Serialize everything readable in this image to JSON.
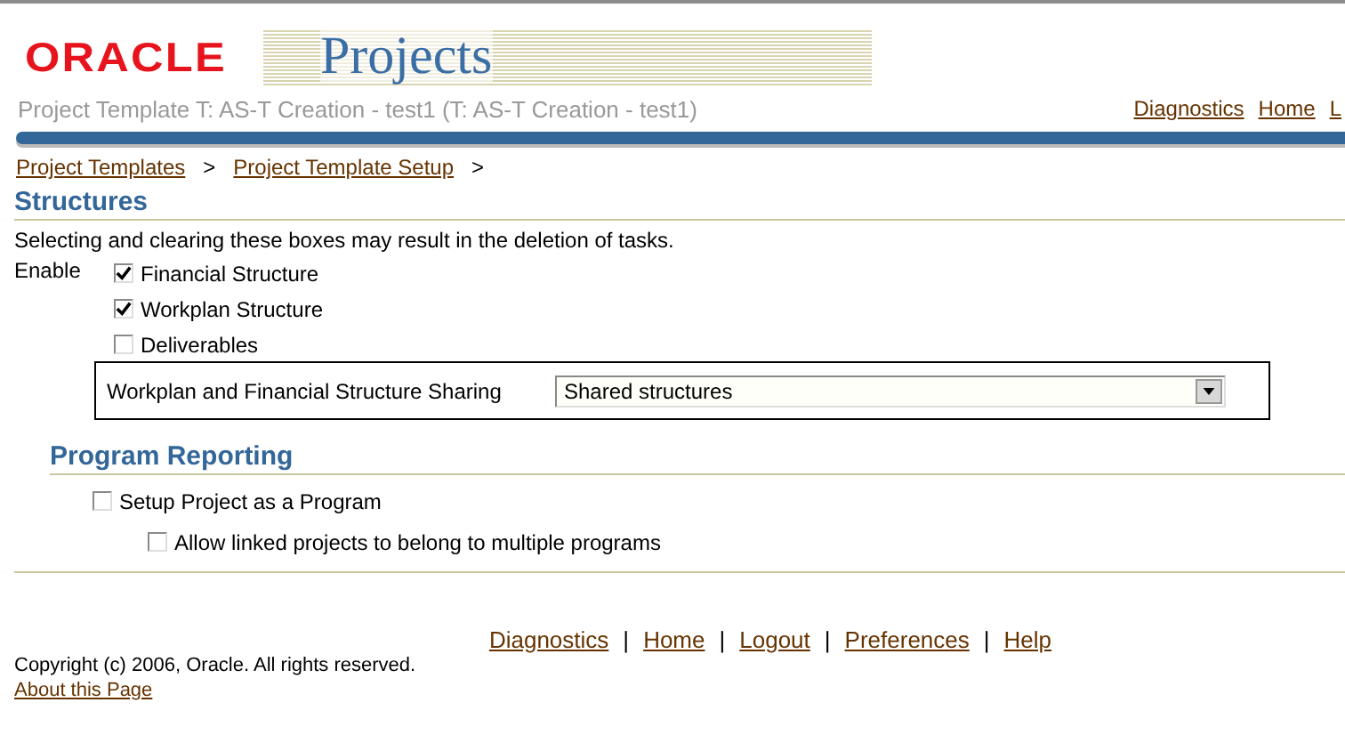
{
  "header": {
    "logo": "ORACLE",
    "product": "Projects",
    "subtitle": "Project Template T: AS-T Creation - test1 (T: AS-T Creation - test1)",
    "global_links": [
      "Diagnostics",
      "Home",
      "L"
    ]
  },
  "breadcrumbs": [
    {
      "label": "Project Templates",
      "separator": ">"
    },
    {
      "label": "Project Template Setup",
      "separator": ">"
    }
  ],
  "structures": {
    "title": "Structures",
    "note": "Selecting and clearing these boxes may result in the deletion of tasks.",
    "enable_label": "Enable",
    "options": [
      {
        "label": "Financial Structure",
        "checked": true
      },
      {
        "label": "Workplan Structure",
        "checked": true
      },
      {
        "label": "Deliverables",
        "checked": false
      }
    ],
    "sharing": {
      "label": "Workplan and Financial Structure Sharing",
      "value": "Shared structures"
    }
  },
  "program_reporting": {
    "title": "Program Reporting",
    "options": [
      {
        "label": "Setup Project as a Program",
        "checked": false,
        "children": [
          {
            "label": "Allow linked projects to belong to multiple programs",
            "checked": false
          }
        ]
      }
    ]
  },
  "footer": {
    "links": [
      {
        "label": "Diagnostics",
        "separator": "|"
      },
      {
        "label": "Home",
        "separator": "|"
      },
      {
        "label": "Logout",
        "separator": "|"
      },
      {
        "label": "Preferences",
        "separator": "|"
      },
      {
        "label": "Help"
      }
    ],
    "copyright": "Copyright (c) 2006, Oracle. All rights reserved.",
    "about_link": "About this Page"
  }
}
